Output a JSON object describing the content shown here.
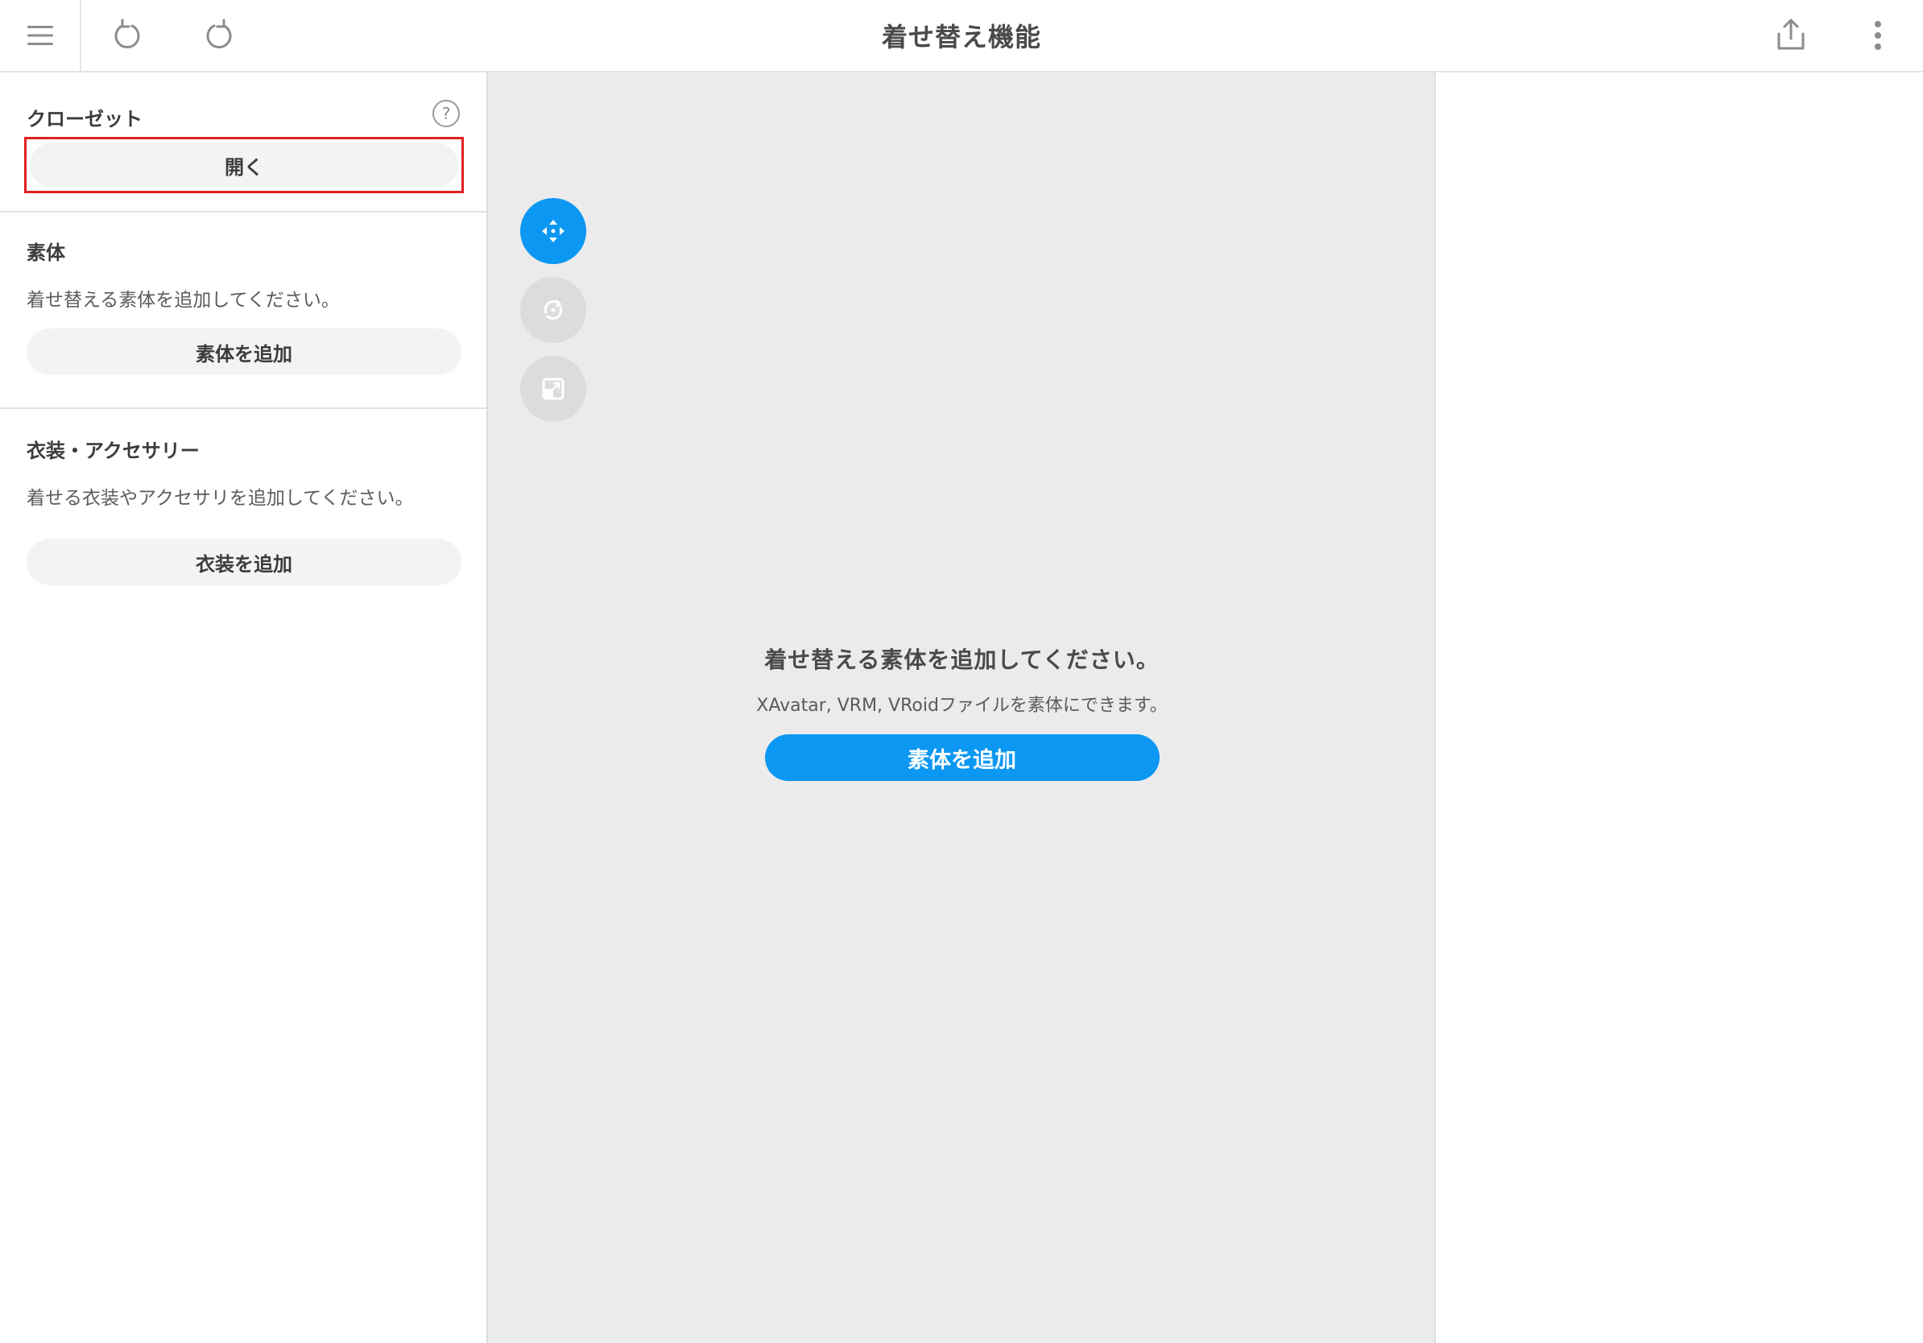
{
  "header": {
    "title": "着せ替え機能",
    "icons": {
      "menu": "menu-icon",
      "undo": "undo-icon",
      "redo": "redo-icon",
      "share": "share-icon",
      "more": "more-vertical-icon"
    }
  },
  "sidebar": {
    "closet": {
      "title": "クローゼット",
      "help_symbol": "?",
      "open_label": "開く"
    },
    "body": {
      "title": "素体",
      "description": "着せ替える素体を追加してください。",
      "add_label": "素体を追加"
    },
    "clothing": {
      "title": "衣装・アクセサリー",
      "description": "着せる衣装やアクセサリを追加してください。",
      "add_label": "衣装を追加"
    }
  },
  "canvas": {
    "tools": [
      "move-icon",
      "rotate-icon",
      "scale-icon"
    ],
    "active_tool": "move-icon",
    "empty_title": "着せ替える素体を追加してください。",
    "empty_subtitle": "XAvatar, VRM, VRoidファイルを素体にできます。",
    "add_button_label": "素体を追加"
  },
  "colors": {
    "accent": "#0c97f2",
    "highlight_border": "#e02020",
    "canvas_bg": "#ebebeb"
  }
}
